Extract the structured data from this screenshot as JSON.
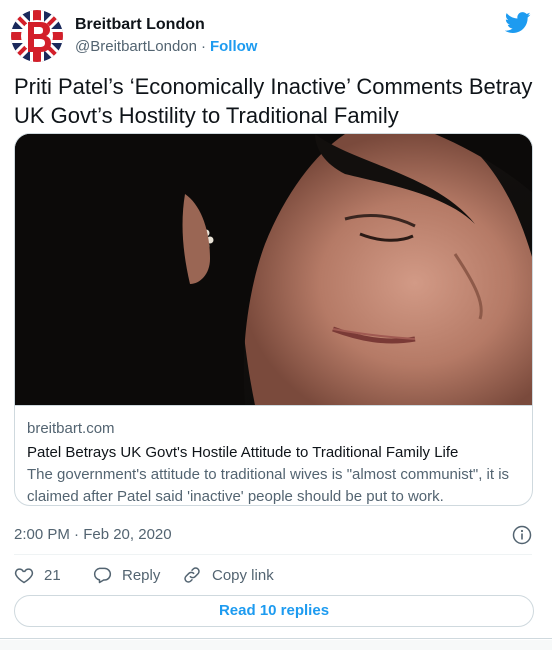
{
  "account": {
    "name": "Breitbart London",
    "handle": "@BreitbartLondon",
    "separator": "·",
    "follow_label": "Follow",
    "avatar_icon": "breitbart-b-union-jack-logo",
    "brand_icon": "twitter-bird-icon"
  },
  "tweet": {
    "text": "Priti Patel’s ‘Economically Inactive’ Comments Betray UK Govt’s Hostility to Traditional Family"
  },
  "link_card": {
    "domain": "breitbart.com",
    "title": "Patel Betrays UK Govt's Hostile Attitude to Traditional Family Life",
    "description": "The government's attitude to traditional wives is \"almost communist\", it is claimed after Patel said 'inactive' people should be put to work."
  },
  "meta": {
    "timestamp": "2:00 PM · Feb 20, 2020",
    "info_icon": "info-icon"
  },
  "actions": {
    "like_count": "21",
    "reply_label": "Reply",
    "copy_link_label": "Copy link",
    "read_replies_label": "Read 10 replies"
  },
  "colors": {
    "accent": "#1d9bf0",
    "text": "#0f1419",
    "muted": "#536471",
    "border": "#cfd9de",
    "brand_red": "#d31f2a",
    "brand_navy": "#1b2a5c"
  }
}
